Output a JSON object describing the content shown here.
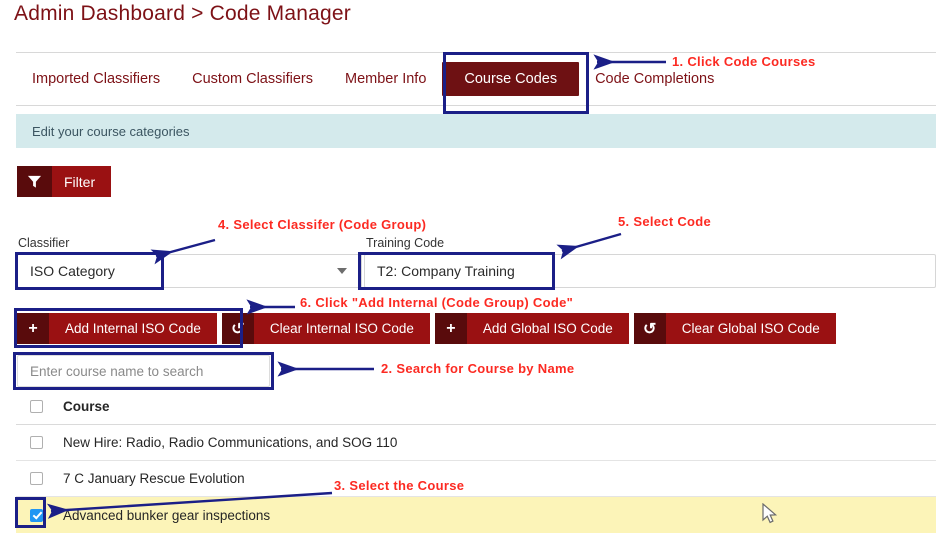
{
  "page": {
    "title": "Admin Dashboard > Code Manager"
  },
  "tabs": [
    {
      "label": "Imported Classifiers",
      "active": false
    },
    {
      "label": "Custom Classifiers",
      "active": false
    },
    {
      "label": "Member Info",
      "active": false
    },
    {
      "label": "Course Codes",
      "active": true
    },
    {
      "label": "Code Completions",
      "active": false
    }
  ],
  "info_bar": {
    "text": "Edit your course categories"
  },
  "filter": {
    "label": "Filter",
    "icon": "funnel-icon"
  },
  "form": {
    "classifier": {
      "label": "Classifier",
      "value": "ISO Category",
      "caret_icon": "chevron-down-icon"
    },
    "training_code": {
      "label": "Training Code",
      "value": "T2: Company Training"
    }
  },
  "actions": [
    {
      "icon": "plus-icon",
      "icon_glyph": "+",
      "label": "Add Internal ISO Code"
    },
    {
      "icon": "undo-icon",
      "icon_glyph": "↺",
      "label": "Clear Internal ISO Code"
    },
    {
      "icon": "plus-icon",
      "icon_glyph": "+",
      "label": "Add Global ISO Code"
    },
    {
      "icon": "undo-icon",
      "icon_glyph": "↺",
      "label": "Clear Global ISO Code"
    }
  ],
  "search": {
    "placeholder": "Enter course name to search",
    "value": ""
  },
  "table": {
    "header": {
      "column": "Course",
      "checked": false
    },
    "rows": [
      {
        "name": "New Hire: Radio, Radio Communications, and SOG 110",
        "checked": false,
        "selected": false
      },
      {
        "name": "7 C January Rescue Evolution",
        "checked": false,
        "selected": false
      },
      {
        "name": "Advanced bunker gear inspections",
        "checked": true,
        "selected": true
      }
    ]
  },
  "annotations": [
    {
      "id": "a1",
      "text": "1. Click Code Courses"
    },
    {
      "id": "a2",
      "text": "2. Search for Course by Name"
    },
    {
      "id": "a3",
      "text": "3. Select the Course"
    },
    {
      "id": "a4",
      "text": "4. Select Classifer (Code Group)"
    },
    {
      "id": "a5",
      "text": "5. Select Code"
    },
    {
      "id": "a6",
      "text": "6. Click \"Add Internal (Code Group) Code\""
    }
  ],
  "colors": {
    "brand_maroon": "#9a1112",
    "brand_maroon_dark": "#590b0c",
    "title_maroon": "#7d1116",
    "info_bar_teal": "#d4eaec",
    "annotation_red": "#fc2a22",
    "annotation_blue": "#1b1f87",
    "selected_row_yellow": "#fcf4b8",
    "checkbox_blue": "#2196f3"
  }
}
